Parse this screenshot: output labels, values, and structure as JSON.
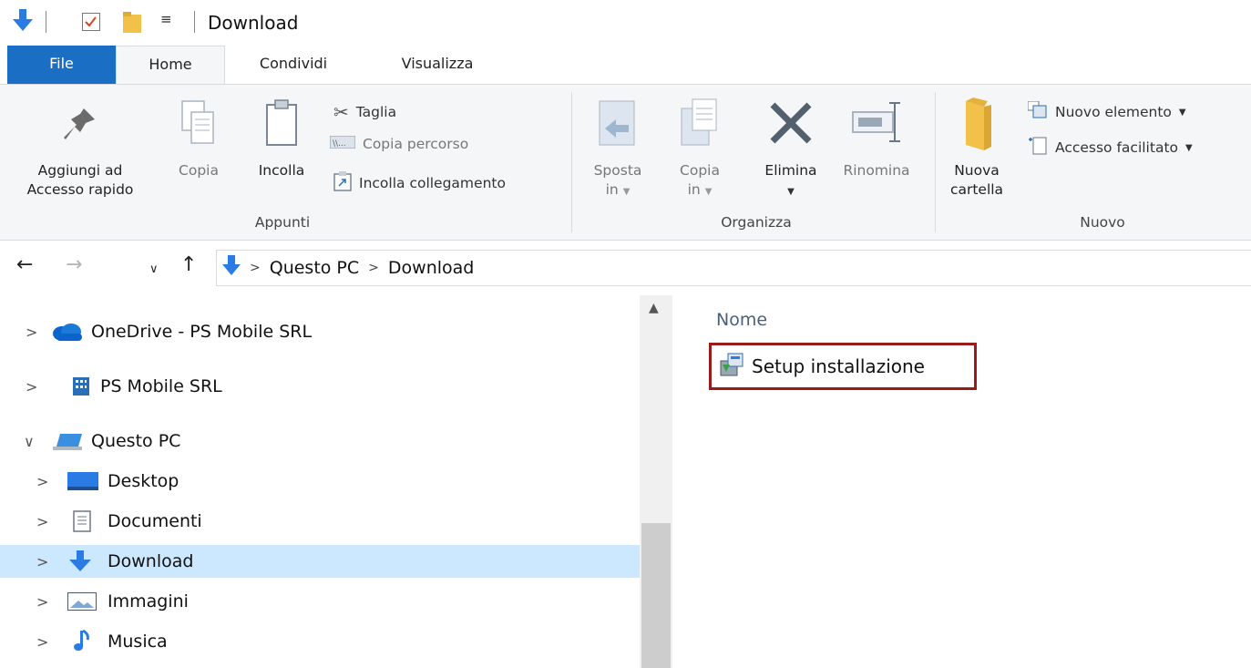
{
  "window": {
    "title": "Download"
  },
  "tabs": [
    {
      "label": "File"
    },
    {
      "label": "Home"
    },
    {
      "label": "Condividi"
    },
    {
      "label": "Visualizza"
    }
  ],
  "ribbon": {
    "appunti": {
      "label": "Appunti",
      "pin_line1": "Aggiungi ad",
      "pin_line2": "Accesso rapido",
      "copy": "Copia",
      "paste": "Incolla",
      "cut": "Taglia",
      "copy_path": "Copia percorso",
      "paste_shortcut": "Incolla collegamento"
    },
    "organizza": {
      "label": "Organizza",
      "move_line1": "Sposta",
      "move_line2": "in",
      "copyto_line1": "Copia",
      "copyto_line2": "in",
      "delete": "Elimina",
      "rename": "Rinomina"
    },
    "nuovo": {
      "label": "Nuovo",
      "new_folder_line1": "Nuova",
      "new_folder_line2": "cartella",
      "new_item": "Nuovo elemento",
      "easy_access": "Accesso facilitato"
    }
  },
  "address": {
    "crumbs": [
      "Questo PC",
      "Download"
    ]
  },
  "navpane": {
    "items": [
      {
        "label": "OneDrive - PS Mobile SRL"
      },
      {
        "label": "PS Mobile SRL"
      },
      {
        "label": "Questo PC"
      },
      {
        "label": "Desktop"
      },
      {
        "label": "Documenti"
      },
      {
        "label": "Download"
      },
      {
        "label": "Immagini"
      },
      {
        "label": "Musica"
      }
    ]
  },
  "content": {
    "column_name": "Nome",
    "files": [
      {
        "name": "Setup installazione"
      }
    ]
  },
  "colors": {
    "file_tab": "#1a6ec4",
    "selection": "#cce8ff",
    "highlight_box": "#9b1b1b",
    "download_arrow": "#2a7be4"
  }
}
